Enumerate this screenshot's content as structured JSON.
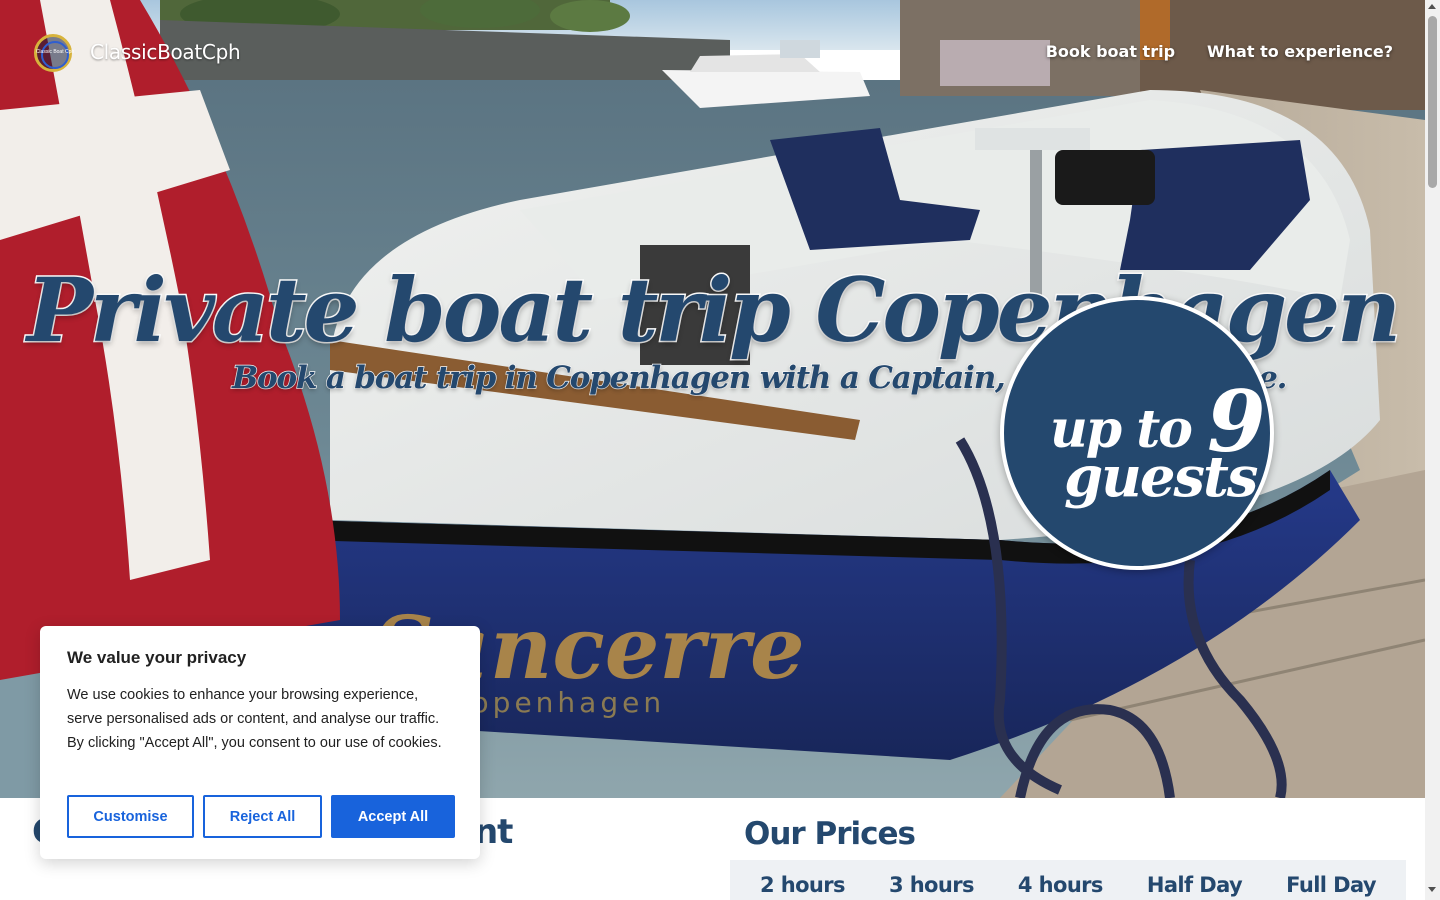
{
  "header": {
    "logo_text": "Classic Boat Cph",
    "brand": "ClassicBoatCph",
    "nav": [
      {
        "label": "Book boat trip"
      },
      {
        "label": "What to experience?"
      }
    ]
  },
  "hero": {
    "title": "Private boat trip Copenhagen",
    "subtitle": "Book a boat trip in Copenhagen with a Captain, Music and Wine.",
    "badge_prefix": "up to",
    "badge_number": "9",
    "badge_suffix": "guests",
    "boat_name": "Sancerre",
    "boat_port": "Copenhagen"
  },
  "below": {
    "left_title_start": "C",
    "left_title_end": "nt",
    "prices_title": "Our Prices",
    "tabs": [
      {
        "label": "2 hours"
      },
      {
        "label": "3 hours"
      },
      {
        "label": "4 hours"
      },
      {
        "label": "Half Day"
      },
      {
        "label": "Full Day"
      }
    ]
  },
  "cookie": {
    "title": "We value your privacy",
    "text": "We use cookies to enhance your browsing experience, serve personalised ads or content, and analyse our traffic. By clicking \"Accept All\", you consent to our use of cookies.",
    "customise": "Customise",
    "reject": "Reject All",
    "accept": "Accept All"
  },
  "colors": {
    "brand_navy": "#24486e",
    "cookie_blue": "#1863dc"
  }
}
